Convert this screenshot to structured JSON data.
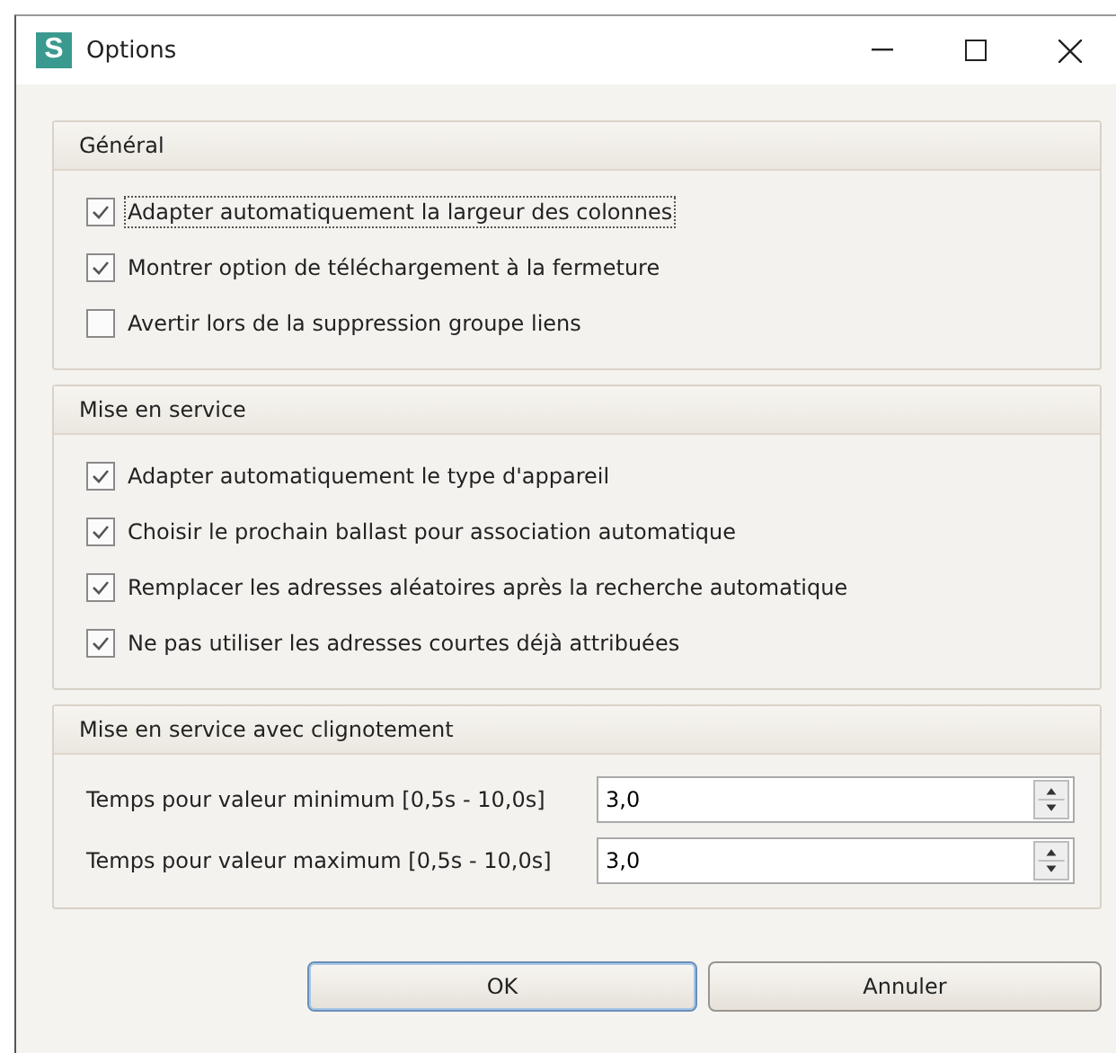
{
  "window": {
    "app_letter": "S",
    "title": "Options"
  },
  "groups": [
    {
      "title": "Général",
      "kind": "checks",
      "items": [
        {
          "label": "Adapter automatiquement la largeur des colonnes",
          "checked": true,
          "focused": true
        },
        {
          "label": "Montrer option de téléchargement à la fermeture",
          "checked": true,
          "focused": false
        },
        {
          "label": "Avertir lors de la suppression groupe liens",
          "checked": false,
          "focused": false
        }
      ]
    },
    {
      "title": "Mise en service",
      "kind": "checks",
      "items": [
        {
          "label": "Adapter automatiquement le type d'appareil",
          "checked": true,
          "focused": false
        },
        {
          "label": "Choisir le prochain ballast pour association automatique",
          "checked": true,
          "focused": false
        },
        {
          "label": "Remplacer les adresses aléatoires après la recherche automatique",
          "checked": true,
          "focused": false
        },
        {
          "label": "Ne pas utiliser les adresses courtes déjà attribuées",
          "checked": true,
          "focused": false
        }
      ]
    },
    {
      "title": "Mise en service avec clignotement",
      "kind": "spins",
      "items": [
        {
          "label": "Temps pour valeur minimum [0,5s - 10,0s]",
          "value": "3,0"
        },
        {
          "label": "Temps pour valeur maximum [0,5s - 10,0s]",
          "value": "3,0"
        }
      ]
    }
  ],
  "buttons": [
    {
      "label": "OK",
      "default": true
    },
    {
      "label": "Annuler",
      "default": false
    }
  ]
}
